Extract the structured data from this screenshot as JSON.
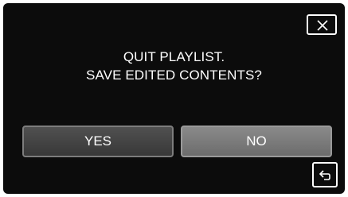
{
  "dialog": {
    "message_line1": "QUIT PLAYLIST.",
    "message_line2": "SAVE EDITED CONTENTS?"
  },
  "buttons": {
    "yes_label": "YES",
    "no_label": "NO"
  },
  "icons": {
    "close": "close-icon",
    "back": "return-arrow-icon"
  },
  "colors": {
    "screen_background": "#0c0c0c",
    "yes_button": "#474747",
    "no_button": "#7b7b7b",
    "text": "#ffffff"
  }
}
